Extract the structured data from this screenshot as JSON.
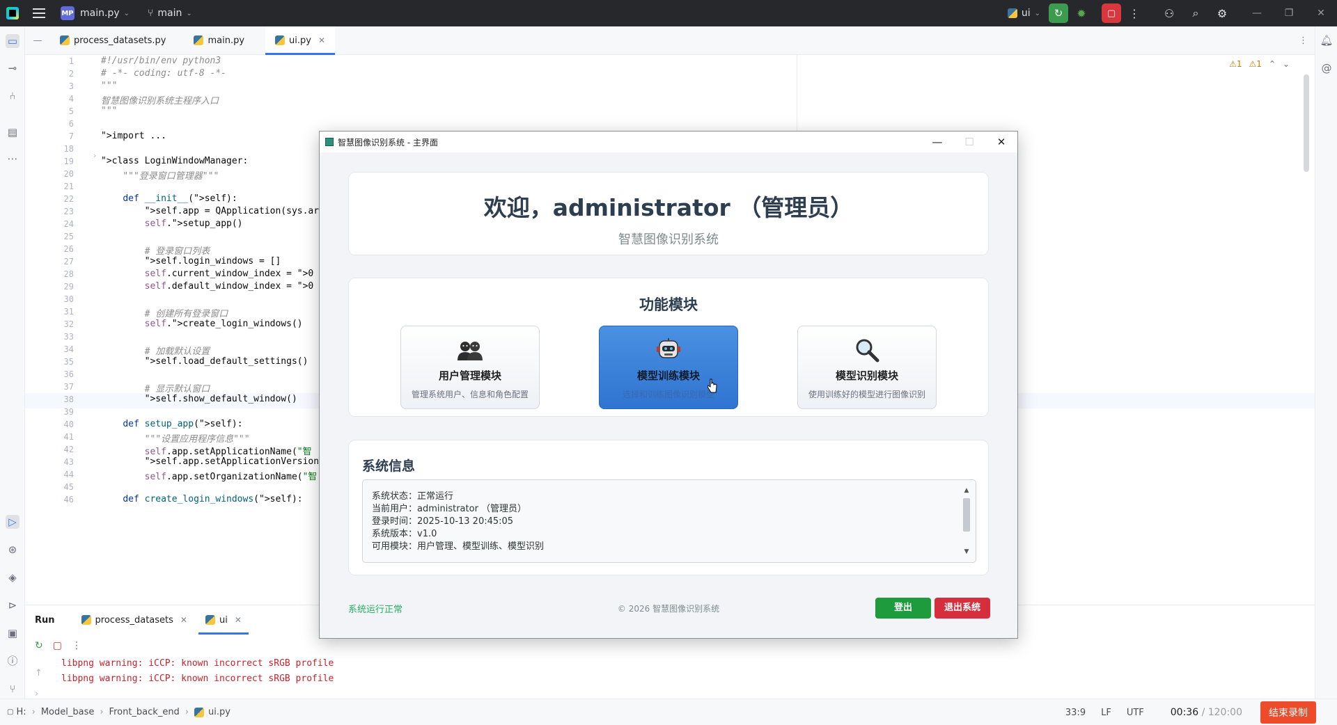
{
  "topbar": {
    "project_badge": "MP",
    "project_name": "main.py",
    "branch": "main",
    "run_config": "ui"
  },
  "editor_tabs": [
    {
      "label": "process_datasets.py"
    },
    {
      "label": "main.py"
    },
    {
      "label": "ui.py"
    }
  ],
  "editor": {
    "warnings": "⚠1",
    "weak_warnings": "⚠1",
    "line_numbers": [
      "1",
      "2",
      "3",
      "4",
      "5",
      "6",
      "7",
      "18",
      "19",
      "20",
      "21",
      "22",
      "23",
      "24",
      "25",
      "26",
      "27",
      "28",
      "29",
      "30",
      "31",
      "32",
      "33",
      "34",
      "35",
      "36",
      "37",
      "38",
      "39",
      "40",
      "41",
      "42",
      "43",
      "44",
      "45",
      "46"
    ],
    "lines": [
      "#!/usr/bin/env python3",
      "# -*- coding: utf-8 -*-",
      "\"\"\"",
      "智慧图像识别系统主程序入口",
      "\"\"\"",
      "",
      "import ...",
      "",
      "class LoginWindowManager:",
      "    \"\"\"登录窗口管理器\"\"\"",
      "",
      "    def __init__(self):",
      "        self.app = QApplication(sys.arg",
      "        self.setup_app()",
      "",
      "        # 登录窗口列表",
      "        self.login_windows = []",
      "        self.current_window_index = 0",
      "        self.default_window_index = 0",
      "",
      "        # 创建所有登录窗口",
      "        self.create_login_windows()",
      "",
      "        # 加载默认设置",
      "        self.load_default_settings()",
      "",
      "        # 显示默认窗口",
      "        self.show_default_window()",
      "",
      "    def setup_app(self):",
      "        \"\"\"设置应用程序信息\"\"\"",
      "        self.app.setApplicationName(\"智",
      "        self.app.setApplicationVersion(",
      "        self.app.setOrganizationName(\"智",
      "",
      "    def create_login_windows(self):"
    ]
  },
  "run_panel": {
    "title": "Run",
    "tabs": [
      {
        "label": "process_datasets"
      },
      {
        "label": "ui"
      }
    ],
    "console": [
      "libpng warning: iCCP: known incorrect sRGB profile",
      "libpng warning: iCCP: known incorrect sRGB profile"
    ]
  },
  "statusbar": {
    "breadcrumbs": [
      "H:",
      "Model_base",
      "Front_back_end",
      "ui.py"
    ],
    "cursor_pos": "33:9",
    "line_sep": "LF",
    "encoding": "UTF",
    "timer_elapsed": "00:36",
    "timer_total": "/ 120:00",
    "record_button": "结束录制"
  },
  "app_window": {
    "title": "智慧图像识别系统 - 主界面",
    "welcome_title": "欢迎，administrator （管理员）",
    "welcome_subtitle": "智慧图像识别系统",
    "modules_heading": "功能模块",
    "modules": [
      {
        "title": "用户管理模块",
        "desc": "管理系统用户、信息和角色配置",
        "icon": "users-icon"
      },
      {
        "title": "模型训练模块",
        "desc": "选择和训练图像识别模型",
        "icon": "robot-icon"
      },
      {
        "title": "模型识别模块",
        "desc": "使用训练好的模型进行图像识别",
        "icon": "magnifier-icon"
      }
    ],
    "info_heading": "系统信息",
    "info_lines": [
      "系统状态：正常运行",
      "当前用户：administrator （管理员）",
      "登录时间：2025-10-13 20:45:05",
      "系统版本：v1.0",
      "可用模块：用户管理、模型训练、模型识别"
    ],
    "footer_status": "系统运行正常",
    "footer_copyright": "© 2026 智慧图像识别系统",
    "logout_label": "登出",
    "exit_label": "退出系统"
  },
  "colors": {
    "accent": "#3574f0",
    "module_hover": "#3a82df",
    "logout_green": "#1e9b3c",
    "exit_red": "#d72e3d",
    "status_green": "#27ae60"
  }
}
